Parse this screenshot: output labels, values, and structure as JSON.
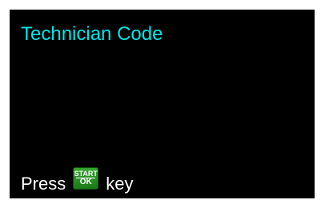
{
  "screen": {
    "title": "Technician Code",
    "title_color": "#00e5e5",
    "background": "#000000"
  },
  "prompt": {
    "before": "Press",
    "after": "key",
    "text_color": "#ffffff",
    "key": {
      "icon": "start-ok-key-icon",
      "line1": "START",
      "line2": "OK",
      "color": "#2e9a28"
    }
  }
}
